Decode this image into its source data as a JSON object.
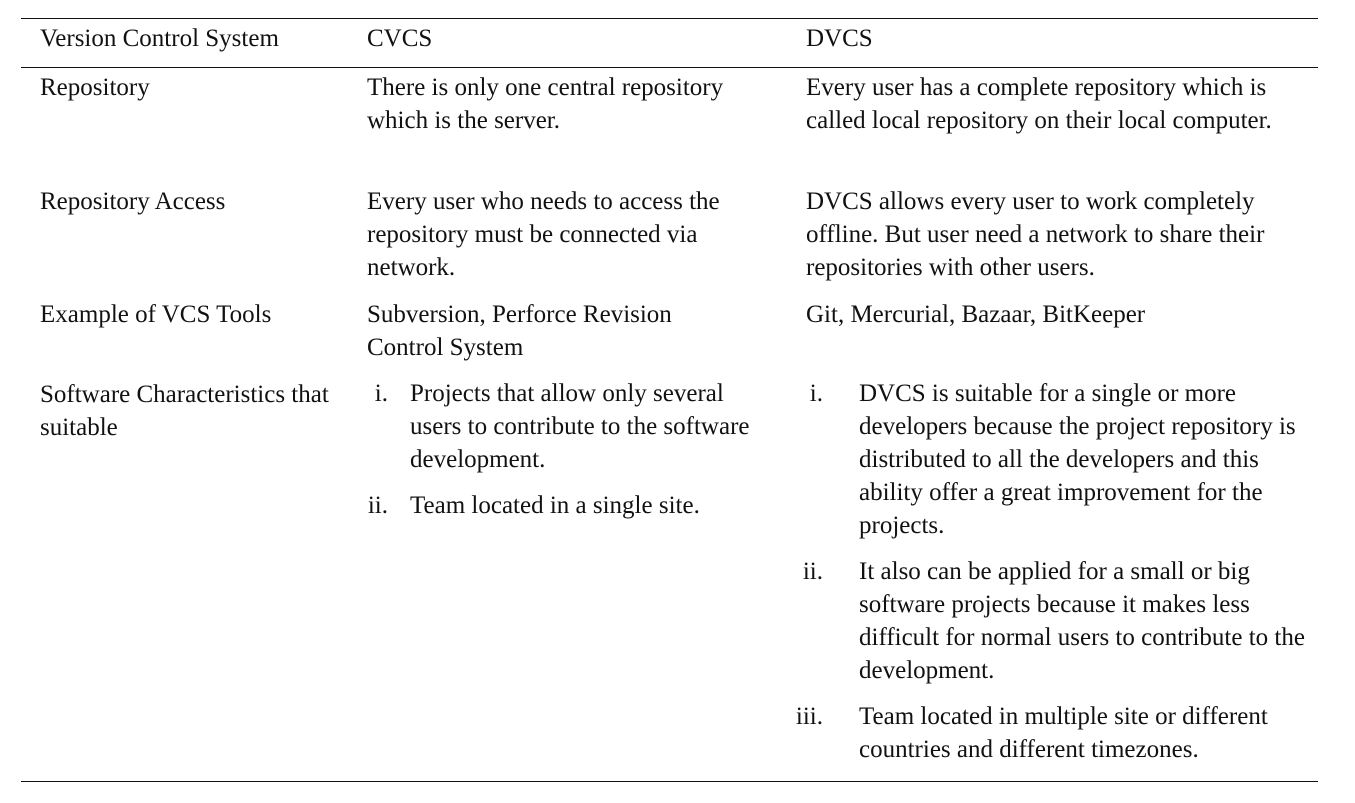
{
  "table": {
    "header": {
      "col1": "Version Control System",
      "col2": "CVCS",
      "col3": "DVCS"
    },
    "rows": [
      {
        "label": "Repository",
        "cvcs": "There is only one central repository which is the server.",
        "dvcs": "Every user has a complete repository which is called local repository on their local computer."
      },
      {
        "label": "Repository Access",
        "cvcs": "Every user who needs to access the repository must be connected via network.",
        "dvcs": "DVCS allows every user to work completely offline. But user need a network to share their repositories with other users."
      },
      {
        "label": "Example of VCS Tools",
        "cvcs": "Subversion, Perforce Revision Control System",
        "dvcs": "Git, Mercurial, Bazaar, BitKeeper"
      },
      {
        "label": "Software Characteristics that suitable",
        "cvcs_items": [
          {
            "num": "i.",
            "text": "Projects that allow only several users to contribute to the software development."
          },
          {
            "num": "ii.",
            "text": "Team located in a single site."
          }
        ],
        "dvcs_items": [
          {
            "num": "i.",
            "text": "DVCS is suitable for a single or more developers because the project repository is distributed to all the developers and this ability offer a great improvement for the projects."
          },
          {
            "num": "ii.",
            "text": "It also can be applied for a small or big software projects because it makes less difficult for normal users to contribute to the development."
          },
          {
            "num": "iii.",
            "text": "Team located in multiple site or different countries and different timezones."
          }
        ]
      }
    ]
  }
}
